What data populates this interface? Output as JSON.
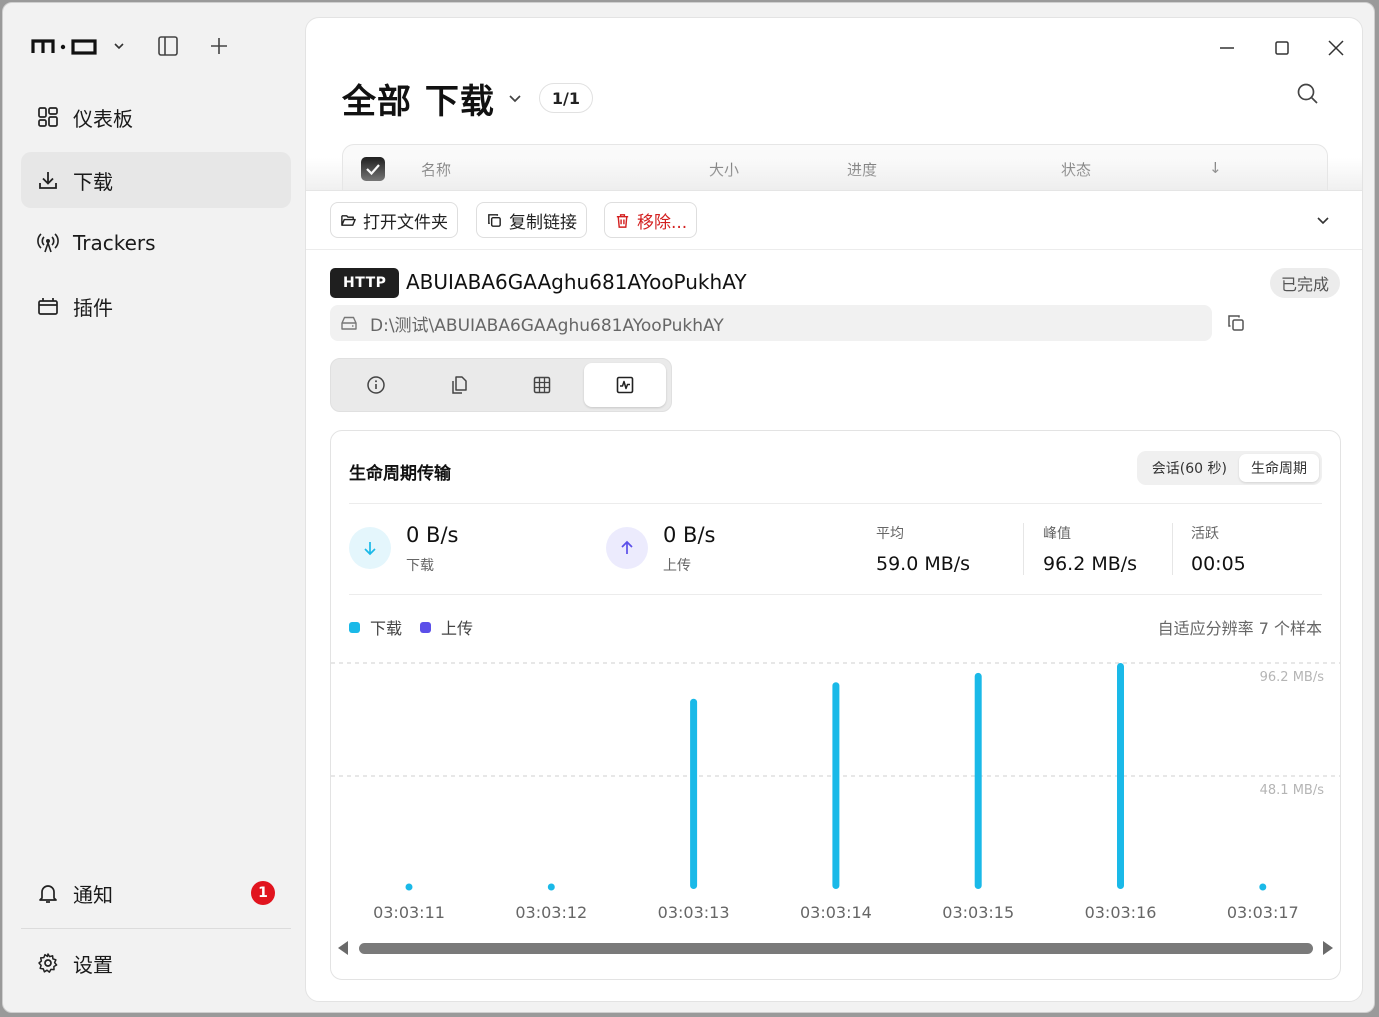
{
  "app": {
    "logo_text": "m·o",
    "colors": {
      "accent_download": "#1ab9e8",
      "accent_upload": "#5b4fe9",
      "danger": "#d32020",
      "badge": "#e1141e"
    }
  },
  "sidebar": {
    "items": [
      {
        "label": "仪表板",
        "icon": "dashboard-icon"
      },
      {
        "label": "下载",
        "icon": "download-icon",
        "active": true
      },
      {
        "label": "Trackers",
        "icon": "broadcast-icon"
      },
      {
        "label": "插件",
        "icon": "plugin-icon"
      }
    ],
    "notifications": {
      "label": "通知",
      "count": "1"
    },
    "settings": {
      "label": "设置"
    }
  },
  "header": {
    "title": "全部 下载",
    "count": "1/1"
  },
  "table": {
    "columns": [
      "名称",
      "大小",
      "进度",
      "状态",
      "↓"
    ]
  },
  "toolbar": {
    "open_folder": "打开文件夹",
    "copy_link": "复制链接",
    "remove": "移除..."
  },
  "detail": {
    "protocol": "HTTP",
    "filename": "ABUIABA6GAAghu681AYooPukhAY",
    "status": "已完成",
    "path": "D:\\测试\\ABUIABA6GAAghu681AYooPukhAY",
    "tabs": [
      "info-icon",
      "files-icon",
      "pieces-icon",
      "activity-icon"
    ],
    "active_tab": 3
  },
  "transfer": {
    "title": "生命周期传输",
    "segments": [
      "会话(60 秒)",
      "生命周期"
    ],
    "active_segment": 1,
    "download_rate": "0 B/s",
    "download_label": "下载",
    "upload_rate": "0 B/s",
    "upload_label": "上传",
    "stats": [
      {
        "label": "平均",
        "value": "59.0 MB/s"
      },
      {
        "label": "峰值",
        "value": "96.2 MB/s"
      },
      {
        "label": "活跃",
        "value": "00:05"
      }
    ],
    "legend": {
      "download": "下载",
      "upload": "上传"
    },
    "resolution_note": "自适应分辨率 7 个样本"
  },
  "chart_data": {
    "type": "bar",
    "categories": [
      "03:03:11",
      "03:03:12",
      "03:03:13",
      "03:03:14",
      "03:03:15",
      "03:03:16",
      "03:03:17"
    ],
    "series": [
      {
        "name": "下载",
        "values": [
          0,
          0,
          81,
          88,
          92,
          96.2,
          0
        ],
        "color": "#1ab9e8"
      },
      {
        "name": "上传",
        "values": [
          0,
          0,
          0,
          0,
          0,
          0,
          0
        ],
        "color": "#5b4fe9"
      }
    ],
    "y_tick_labels": [
      "96.2 MB/s",
      "48.1 MB/s"
    ],
    "y_ticks": [
      96.2,
      48.1
    ],
    "ylim": [
      0,
      96.2
    ],
    "grid": true,
    "legend_position": "top-left"
  }
}
